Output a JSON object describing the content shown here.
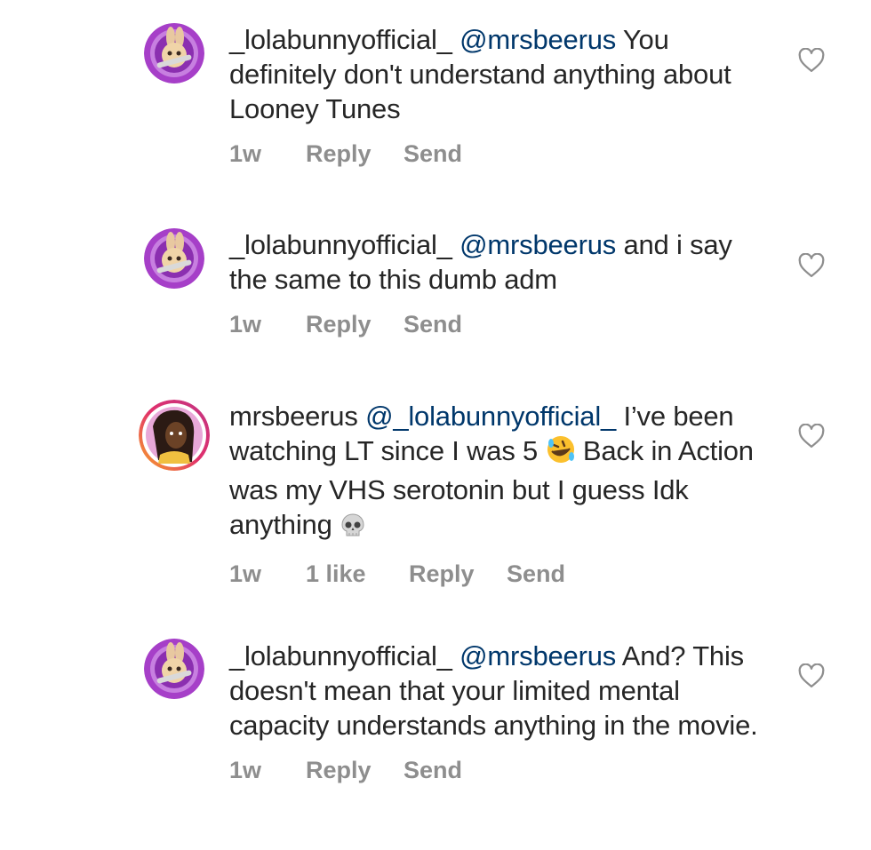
{
  "comments": [
    {
      "username": "_lolabunnyofficial_",
      "mention": "@mrsbeerus",
      "text": " You definitely don't understand anything about Looney Tunes",
      "time": "1w",
      "reply_label": "Reply",
      "send_label": "Send"
    },
    {
      "username": "_lolabunnyofficial_",
      "mention": "@mrsbeerus",
      "text": " and i say the same to this dumb adm",
      "time": "1w",
      "reply_label": "Reply",
      "send_label": "Send"
    },
    {
      "username": "mrsbeerus",
      "mention": "@_lolabunnyofficial_",
      "text_a": "  I’ve been watching LT since I was 5 ",
      "text_b": " Back in Action was my VHS serotonin but I guess Idk anything ",
      "emoji_1": "rolling-on-floor-laughing-emoji",
      "emoji_2": "skull-emoji",
      "time": "1w",
      "likes": "1 like",
      "reply_label": "Reply",
      "send_label": "Send"
    },
    {
      "username": "_lolabunnyofficial_",
      "mention": "@mrsbeerus",
      "text": " And? This doesn't mean that your limited mental capacity understands anything in the movie.",
      "time": "1w",
      "reply_label": "Reply",
      "send_label": "Send"
    }
  ],
  "colors": {
    "text": "#262626",
    "mention": "#00376b",
    "meta": "#8e8e8e",
    "heart_outline": "#8e8e8e",
    "lola_ring": "#a63fc8",
    "beerus_ring_gradient": [
      "#f9a825",
      "#e1306c",
      "#c13584"
    ]
  },
  "icons": {
    "like": "heart-outline-icon"
  }
}
